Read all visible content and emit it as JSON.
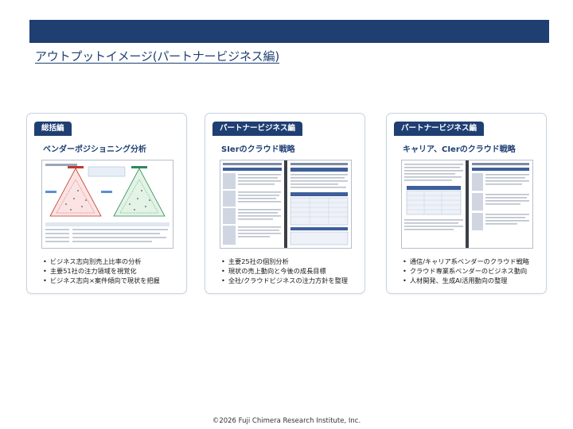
{
  "header": {
    "title": "アウトプットイメージ(パートナービジネス編)"
  },
  "cards": [
    {
      "badge": "総括編",
      "heading": "ベンダーポジショニング分析",
      "bullets": [
        "ビジネス志向別売上比率の分析",
        "主要51社の注力領域を視覚化",
        "ビジネス志向×案件傾向で現状を把握"
      ]
    },
    {
      "badge": "パートナービジネス編",
      "heading": "SIerのクラウド戦略",
      "bullets": [
        "主要25社の個別分析",
        "現状の売上動向と今後の成長目標",
        "全社/クラウドビジネスの注力方針を整理"
      ]
    },
    {
      "badge": "パートナービジネス編",
      "heading": "キャリア、CIerのクラウド戦略",
      "bullets": [
        "通信/キャリア系ベンダーのクラウド戦略",
        "クラウド専業系ベンダーのビジネス動向",
        "人材開発、生成AI活用動向の整理"
      ]
    }
  ],
  "footer": {
    "copyright": "©2026 Fuji Chimera Research Institute, Inc."
  },
  "colors": {
    "brand_navy": "#1f3f73",
    "card_border": "#c9d3e0"
  }
}
